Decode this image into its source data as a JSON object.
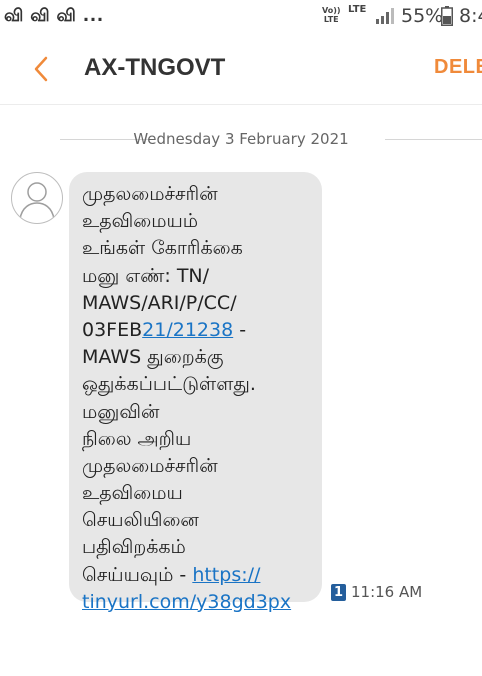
{
  "status_bar": {
    "notification_text": "வி வி வி ...",
    "volte": "Vo)) LTE",
    "network": "LTE",
    "battery_percent": "55%",
    "time": "8:4"
  },
  "app_bar": {
    "back_icon": "chevron-left-icon",
    "contact_name": "AX-TNGOVT",
    "delete_label": "DELE"
  },
  "conversation": {
    "date": "Wednesday 3 February 2021",
    "message": {
      "line_1": "முதலமைச்சரின்",
      "line_2": "உதவிமையம்",
      "line_3": "உங்கள் கோரிக்கை",
      "line_4": "மனு எண்: TN/",
      "line_5": "MAWS/ARI/P/CC/",
      "line_6_plain": "03FEB",
      "line_6_link": "21/21238",
      "line_6_tail": " -",
      "line_7": "MAWS துறைக்கு",
      "line_8": "ஒதுக்கப்பட்டுள்ளது.",
      "line_9": "மனுவின்",
      "line_10": "நிலை அறிய",
      "line_11": "முதலமைச்சரின்",
      "line_12": "உதவிமைய",
      "line_13": "செயலியினை",
      "line_14": "பதிவிறக்கம்",
      "line_15_plain": "செய்யவும் - ",
      "line_15_link": "https://",
      "line_16_link": "tinyurl.com/y38gd3px"
    },
    "sim_slot": "1",
    "time": "11:16 AM"
  },
  "colors": {
    "accent": "#f08a3a",
    "link": "#1a74c5",
    "bubble": "#e7e7e7",
    "sim_badge": "#245e9c"
  }
}
